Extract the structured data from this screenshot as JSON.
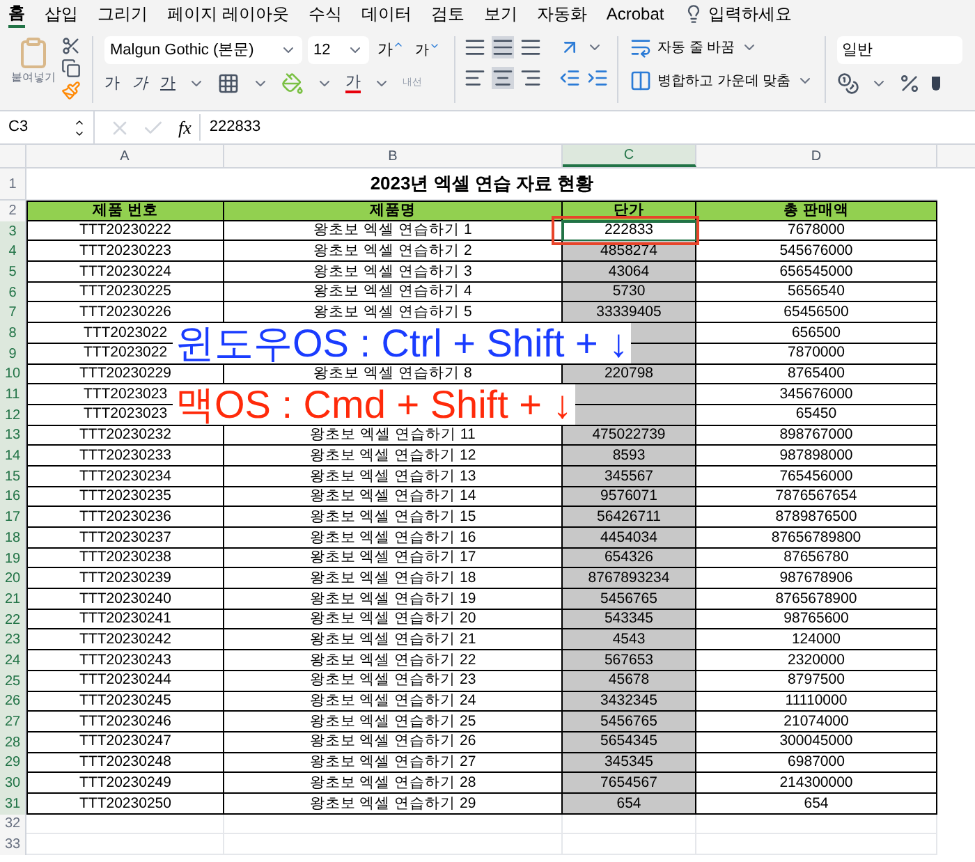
{
  "menu_tabs": [
    {
      "label": "홈",
      "selected": true
    },
    {
      "label": "삽입",
      "selected": false
    },
    {
      "label": "그리기",
      "selected": false
    },
    {
      "label": "페이지 레이아웃",
      "selected": false
    },
    {
      "label": "수식",
      "selected": false
    },
    {
      "label": "데이터",
      "selected": false
    },
    {
      "label": "검토",
      "selected": false
    },
    {
      "label": "보기",
      "selected": false
    },
    {
      "label": "자동화",
      "selected": false
    },
    {
      "label": "Acrobat",
      "selected": false
    }
  ],
  "tell_me": "입력하세요",
  "ribbon": {
    "paste_label": "붙여넣기",
    "font_name": "Malgun Gothic (본문)",
    "font_size": "12",
    "grow_font": "가",
    "shrink_font": "가",
    "bold": "가",
    "italic": "가",
    "underline": "가",
    "font_color": "가",
    "phonetic": "내선",
    "wrap_text": "자동 줄 바꿈",
    "merge_center": "병합하고 가운데 맞춤",
    "number_format": "일반"
  },
  "formula_bar": {
    "name_box": "C3",
    "fx": "fx",
    "value": "222833"
  },
  "sheet": {
    "columns": [
      "A",
      "B",
      "C",
      "D"
    ],
    "title_row": "1",
    "title": "2023년 엑셀 연습 자료 현황",
    "header_row": "2",
    "headers": [
      "제품 번호",
      "제품명",
      "단가",
      "총 판매액"
    ],
    "rows": [
      {
        "num": "3",
        "a": "TTT20230222",
        "b": "왕초보 엑셀 연습하기 1",
        "c": "222833",
        "d": "7678000",
        "selected": false,
        "active": true
      },
      {
        "num": "4",
        "a": "TTT20230223",
        "b": "왕초보 엑셀 연습하기 2",
        "c": "4858274",
        "d": "545676000",
        "selected": true,
        "active": false
      },
      {
        "num": "5",
        "a": "TTT20230224",
        "b": "왕초보 엑셀 연습하기 3",
        "c": "43064",
        "d": "656545000",
        "selected": true,
        "active": false
      },
      {
        "num": "6",
        "a": "TTT20230225",
        "b": "왕초보 엑셀 연습하기 4",
        "c": "5730",
        "d": "5656540",
        "selected": true,
        "active": false
      },
      {
        "num": "7",
        "a": "TTT20230226",
        "b": "왕초보 엑셀 연습하기 5",
        "c": "33339405",
        "d": "65456500",
        "selected": true,
        "active": false
      },
      {
        "num": "8",
        "a": "TTT2023022",
        "d": "656500",
        "selected": true,
        "active": false
      },
      {
        "num": "9",
        "a": "TTT2023022",
        "d": "7870000",
        "selected": true,
        "active": false
      },
      {
        "num": "10",
        "a": "TTT20230229",
        "b": "왕초보 엑셀 연습하기 8",
        "c": "220798",
        "d": "8765400",
        "selected": true,
        "active": false
      },
      {
        "num": "11",
        "a": "TTT2023023",
        "d": "345676000",
        "selected": true,
        "active": false
      },
      {
        "num": "12",
        "a": "TTT2023023",
        "d": "65450",
        "selected": true,
        "active": false
      },
      {
        "num": "13",
        "a": "TTT20230232",
        "b": "왕초보 엑셀 연습하기 11",
        "c": "475022739",
        "d": "898767000",
        "selected": true,
        "active": false
      },
      {
        "num": "14",
        "a": "TTT20230233",
        "b": "왕초보 엑셀 연습하기 12",
        "c": "8593",
        "d": "987898000",
        "selected": true,
        "active": false
      },
      {
        "num": "15",
        "a": "TTT20230234",
        "b": "왕초보 엑셀 연습하기 13",
        "c": "345567",
        "d": "765456000",
        "selected": true,
        "active": false
      },
      {
        "num": "16",
        "a": "TTT20230235",
        "b": "왕초보 엑셀 연습하기 14",
        "c": "9576071",
        "d": "7876567654",
        "selected": true,
        "active": false
      },
      {
        "num": "17",
        "a": "TTT20230236",
        "b": "왕초보 엑셀 연습하기 15",
        "c": "56426711",
        "d": "8789876500",
        "selected": true,
        "active": false
      },
      {
        "num": "18",
        "a": "TTT20230237",
        "b": "왕초보 엑셀 연습하기 16",
        "c": "4454034",
        "d": "87656789800",
        "selected": true,
        "active": false
      },
      {
        "num": "19",
        "a": "TTT20230238",
        "b": "왕초보 엑셀 연습하기 17",
        "c": "654326",
        "d": "87656780",
        "selected": true,
        "active": false
      },
      {
        "num": "20",
        "a": "TTT20230239",
        "b": "왕초보 엑셀 연습하기 18",
        "c": "8767893234",
        "d": "987678906",
        "selected": true,
        "active": false
      },
      {
        "num": "21",
        "a": "TTT20230240",
        "b": "왕초보 엑셀 연습하기 19",
        "c": "5456765",
        "d": "8765678900",
        "selected": true,
        "active": false
      },
      {
        "num": "22",
        "a": "TTT20230241",
        "b": "왕초보 엑셀 연습하기 20",
        "c": "543345",
        "d": "98765600",
        "selected": true,
        "active": false
      },
      {
        "num": "23",
        "a": "TTT20230242",
        "b": "왕초보 엑셀 연습하기 21",
        "c": "4543",
        "d": "124000",
        "selected": true,
        "active": false
      },
      {
        "num": "24",
        "a": "TTT20230243",
        "b": "왕초보 엑셀 연습하기 22",
        "c": "567653",
        "d": "2320000",
        "selected": true,
        "active": false
      },
      {
        "num": "25",
        "a": "TTT20230244",
        "b": "왕초보 엑셀 연습하기 23",
        "c": "45678",
        "d": "8797500",
        "selected": true,
        "active": false
      },
      {
        "num": "26",
        "a": "TTT20230245",
        "b": "왕초보 엑셀 연습하기 24",
        "c": "3432345",
        "d": "11110000",
        "selected": true,
        "active": false
      },
      {
        "num": "27",
        "a": "TTT20230246",
        "b": "왕초보 엑셀 연습하기 25",
        "c": "5456765",
        "d": "21074000",
        "selected": true,
        "active": false
      },
      {
        "num": "28",
        "a": "TTT20230247",
        "b": "왕초보 엑셀 연습하기 26",
        "c": "5654345",
        "d": "300045000",
        "selected": true,
        "active": false
      },
      {
        "num": "29",
        "a": "TTT20230248",
        "b": "왕초보 엑셀 연습하기 27",
        "c": "345345",
        "d": "6987000",
        "selected": true,
        "active": false
      },
      {
        "num": "30",
        "a": "TTT20230249",
        "b": "왕초보 엑셀 연습하기 28",
        "c": "7654567",
        "d": "214300000",
        "selected": true,
        "active": false
      },
      {
        "num": "31",
        "a": "TTT20230250",
        "b": "왕초보 엑셀 연습하기 29",
        "c": "654",
        "d": "654",
        "selected": true,
        "active": false
      }
    ],
    "empty_rows": [
      "32",
      "33"
    ]
  },
  "overlay": [
    {
      "text": "윈도우OS : Ctrl + Shift + ↓",
      "color": "#1a3cff"
    },
    {
      "text": "맥OS : Cmd + Shift + ↓",
      "color": "#ff2a0a"
    }
  ]
}
